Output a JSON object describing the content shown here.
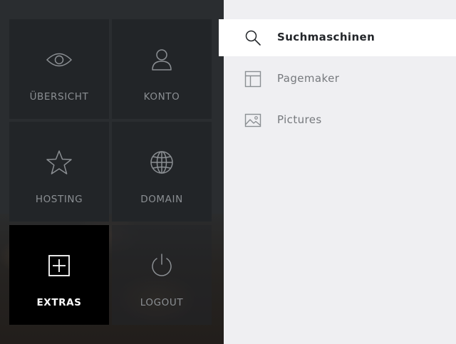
{
  "tiles": [
    {
      "label": "ÜBERSICHT",
      "icon": "eye-icon",
      "active": false
    },
    {
      "label": "KONTO",
      "icon": "user-icon",
      "active": false
    },
    {
      "label": "HOSTING",
      "icon": "star-icon",
      "active": false
    },
    {
      "label": "DOMAIN",
      "icon": "globe-icon",
      "active": false
    },
    {
      "label": "EXTRAS",
      "icon": "plus-square-icon",
      "active": true
    },
    {
      "label": "LOGOUT",
      "icon": "power-icon",
      "active": false
    }
  ],
  "submenu": [
    {
      "label": "Suchmaschinen",
      "icon": "search-icon",
      "active": true
    },
    {
      "label": "Pagemaker",
      "icon": "layout-icon",
      "active": false
    },
    {
      "label": "Pictures",
      "icon": "image-icon",
      "active": false
    }
  ],
  "colors": {
    "sidebar_background": "#2a2d30",
    "tile_background": "#222528",
    "tile_active_background": "#000000",
    "tile_label": "#8b8f93",
    "submenu_background": "#efeff2",
    "submenu_active_background": "#ffffff",
    "submenu_label": "#76797d",
    "submenu_active_label": "#23262a"
  }
}
